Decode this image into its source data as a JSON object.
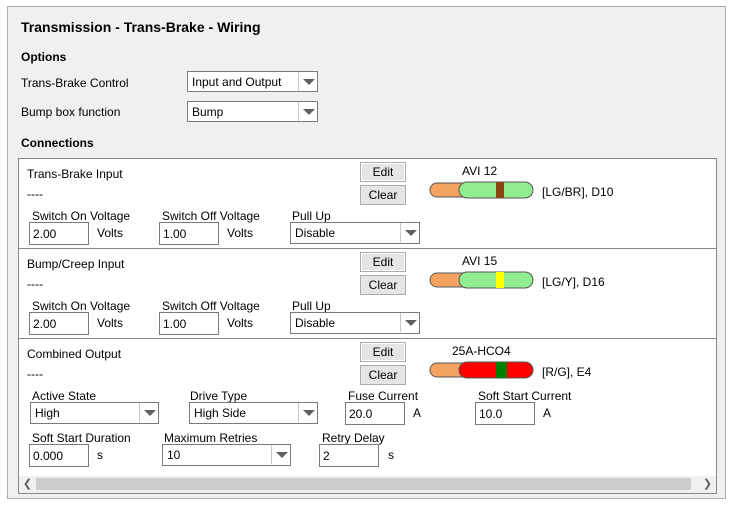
{
  "title": "Transmission - Trans-Brake - Wiring",
  "options": {
    "heading": "Options",
    "trans_brake_control_label": "Trans-Brake Control",
    "trans_brake_control_value": "Input and Output",
    "bump_box_label": "Bump box function",
    "bump_box_value": "Bump"
  },
  "connections": {
    "heading": "Connections",
    "sections": [
      {
        "name": "Trans-Brake Input",
        "status": "----",
        "edit_label": "Edit",
        "clear_label": "Clear",
        "pin": "AVI 12",
        "wire_label": "[LG/BR], D10",
        "colors": {
          "base": "#90ee90",
          "stripe": "#8b4513",
          "insulation": "#f4a460"
        },
        "fields": {
          "switch_on_label": "Switch On Voltage",
          "switch_on_value": "2.00",
          "switch_on_unit": "Volts",
          "switch_off_label": "Switch Off Voltage",
          "switch_off_value": "1.00",
          "switch_off_unit": "Volts",
          "pull_up_label": "Pull Up",
          "pull_up_value": "Disable"
        }
      },
      {
        "name": "Bump/Creep Input",
        "status": "----",
        "edit_label": "Edit",
        "clear_label": "Clear",
        "pin": "AVI 15",
        "wire_label": "[LG/Y], D16",
        "colors": {
          "base": "#90ee90",
          "stripe": "#ffff00",
          "insulation": "#f4a460"
        },
        "fields": {
          "switch_on_label": "Switch On Voltage",
          "switch_on_value": "2.00",
          "switch_on_unit": "Volts",
          "switch_off_label": "Switch Off Voltage",
          "switch_off_value": "1.00",
          "switch_off_unit": "Volts",
          "pull_up_label": "Pull Up",
          "pull_up_value": "Disable"
        }
      },
      {
        "name": "Combined Output",
        "status": "----",
        "edit_label": "Edit",
        "clear_label": "Clear",
        "pin": "25A-HCO4",
        "wire_label": "[R/G], E4",
        "colors": {
          "base": "#ff0000",
          "stripe": "#008000",
          "insulation": "#f4a460"
        },
        "fields": {
          "active_state_label": "Active State",
          "active_state_value": "High",
          "drive_type_label": "Drive Type",
          "drive_type_value": "High Side",
          "fuse_current_label": "Fuse Current",
          "fuse_current_value": "20.0",
          "fuse_current_unit": "A",
          "soft_start_current_label": "Soft Start Current",
          "soft_start_current_value": "10.0",
          "soft_start_current_unit": "A",
          "soft_start_duration_label": "Soft Start Duration",
          "soft_start_duration_value": "0.000",
          "soft_start_duration_unit": "s",
          "max_retries_label": "Maximum Retries",
          "max_retries_value": "10",
          "retry_delay_label": "Retry Delay",
          "retry_delay_value": "2",
          "retry_delay_unit": "s"
        }
      }
    ]
  },
  "scrollbar": {
    "left_icon": "chevron-left-icon",
    "right_icon": "chevron-right-icon"
  }
}
